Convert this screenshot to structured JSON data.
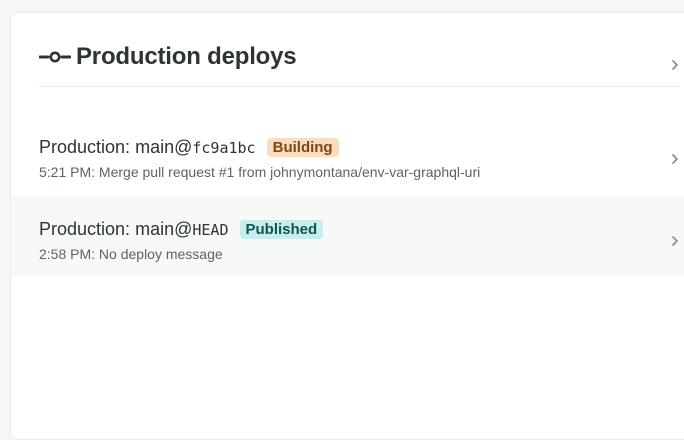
{
  "panel": {
    "title": "Production deploys",
    "header_icon": "git-commit-icon",
    "chevron_icon": "chevron-right-icon"
  },
  "deploys": [
    {
      "context": "Production:",
      "branch": "main@",
      "commit": "fc9a1bc",
      "status": "Building",
      "time": "5:21 PM:",
      "message": "Merge pull request #1 from johnymontana/env-var-graphql-uri"
    },
    {
      "context": "Production:",
      "branch": "main@",
      "commit": "HEAD",
      "status": "Published",
      "time": "2:58 PM:",
      "message": "No deploy message"
    }
  ],
  "colors": {
    "building_bg": "#fbdcc0",
    "building_text": "#7a4a14",
    "published_bg": "#c9ecec",
    "published_text": "#0d5557"
  }
}
